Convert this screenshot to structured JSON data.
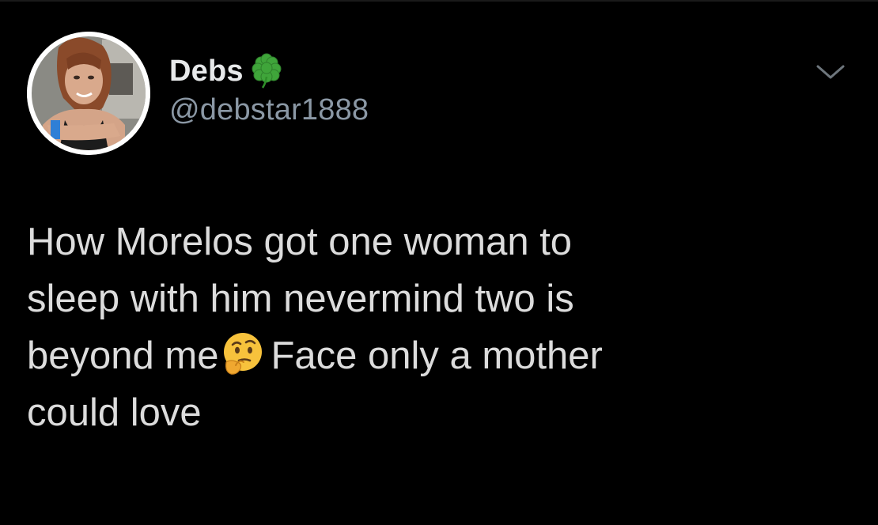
{
  "tweet": {
    "author": {
      "display_name": "Debs",
      "name_emoji": "four-leaf-clover-icon",
      "handle": "@debstar1888"
    },
    "menu_icon": "chevron-down-icon",
    "text": {
      "line1": "How Morelos got one woman to",
      "line2": "sleep with him nevermind two is",
      "line3_before": "beyond me",
      "line3_emoji": "thinking-face-icon",
      "line3_after": "Face only a mother",
      "line4": "could love"
    }
  },
  "colors": {
    "background": "#000000",
    "name": "#e7e9ea",
    "handle": "#8b98a5",
    "body_text": "#dcdcdc",
    "clover": "#3fa53a",
    "emoji": "#f7c23c"
  }
}
